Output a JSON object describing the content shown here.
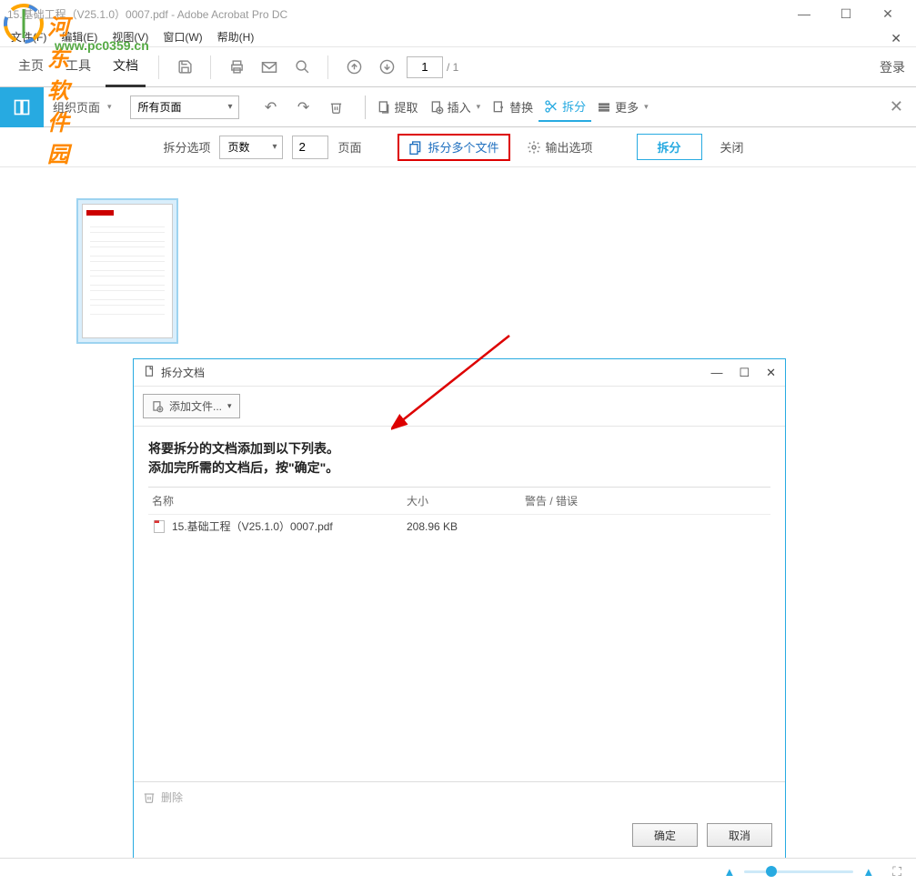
{
  "window": {
    "title": "15.基础工程（V25.1.0）0007.pdf - Adobe Acrobat Pro DC"
  },
  "watermark": {
    "brand": "河东软件园",
    "url": "www.pc0359.cn"
  },
  "menubar": {
    "file": "文件(F)",
    "edit": "编辑(E)",
    "view": "视图(V)",
    "window": "窗口(W)",
    "help": "帮助(H)"
  },
  "tabs": {
    "home": "主页",
    "tools": "工具",
    "document": "文档",
    "page_current": "1",
    "page_total": "/ 1",
    "login": "登录"
  },
  "orgbar": {
    "organize_label": "组织页面",
    "page_filter": "所有页面",
    "extract": "提取",
    "insert": "插入",
    "replace": "替换",
    "split": "拆分",
    "more": "更多"
  },
  "splitbar": {
    "split_option_label": "拆分选项",
    "split_by": "页数",
    "split_value": "2",
    "pages_label": "页面",
    "split_multiple": "拆分多个文件",
    "output_options": "输出选项",
    "split_button": "拆分",
    "close": "关闭"
  },
  "dialog": {
    "title": "拆分文档",
    "add_files": "添加文件...",
    "instruction_line1": "将要拆分的文档添加到以下列表。",
    "instruction_line2": "添加完所需的文档后，按\"确定\"。",
    "columns": {
      "name": "名称",
      "size": "大小",
      "warning": "警告 / 错误"
    },
    "files": [
      {
        "name": "15.基础工程（V25.1.0）0007.pdf",
        "size": "208.96 KB",
        "warning": ""
      }
    ],
    "delete": "删除",
    "ok": "确定",
    "cancel": "取消"
  }
}
